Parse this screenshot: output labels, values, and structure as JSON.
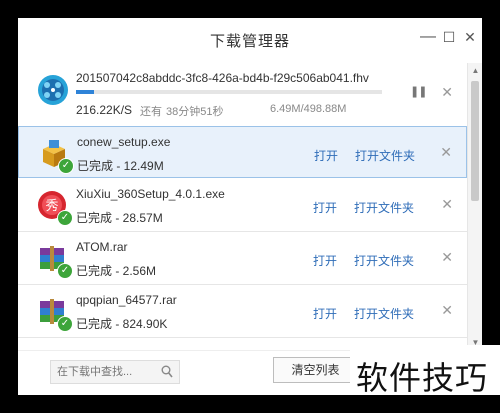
{
  "window": {
    "title": "下载管理器",
    "minimize_icon": "—",
    "maximize_icon": "☐",
    "close_icon": "✕"
  },
  "active_download": {
    "filename": "201507042c8abddc-3fc8-426a-bd4b-f29c506ab041.fhv",
    "progress": 0.013,
    "speed": "216.22K/S",
    "remain_label": "还有",
    "remain_time": "38分钟51秒",
    "sizes": "6.49M/498.88M",
    "pause_icon": "❚❚",
    "close_icon": "✕"
  },
  "downloads": [
    {
      "filename": "conew_setup.exe",
      "status": "已完成 - 12.49M",
      "icon": "package-icon"
    },
    {
      "filename": "XiuXiu_360Setup_4.0.1.exe",
      "status": "已完成 - 28.57M",
      "icon": "xiuxiu-icon"
    },
    {
      "filename": "ATOM.rar",
      "status": "已完成 - 2.56M",
      "icon": "rar-archive-icon"
    },
    {
      "filename": "qpqpian_64577.rar",
      "status": "已完成 - 824.90K",
      "icon": "rar-archive-icon"
    }
  ],
  "actions": {
    "open": "打开",
    "open_folder": "打开文件夹",
    "remove": "✕"
  },
  "search": {
    "placeholder": "在下载中查找..."
  },
  "clear_button": "清空列表",
  "watermark": "软件技巧",
  "colors": {
    "accent": "#2e83d8",
    "link": "#2f6db8",
    "selected_row": "#e8f1fb",
    "done_badge": "#3da53a"
  }
}
